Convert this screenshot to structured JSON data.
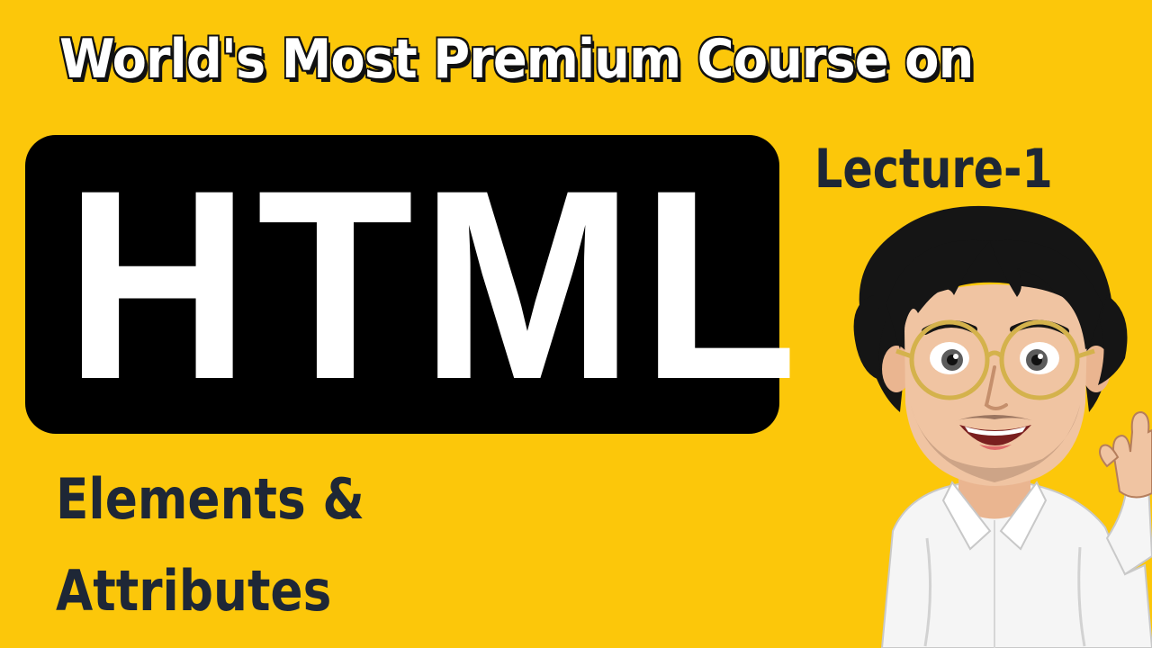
{
  "headline": "World's Most Premium Course on",
  "title": "HTML",
  "lecture": "Lecture-1",
  "subtitle": {
    "line1": "Elements &",
    "line2": "Attributes"
  },
  "mascot": {
    "icon": "cartoon-teacher-waving",
    "colors": {
      "background": "#fcc70a",
      "title_box": "#000000",
      "text_dark": "#1e2736",
      "hair": "#151515",
      "skin": "#f0c4a2",
      "shirt": "#f5f5f5",
      "glasses": "#d4b24c"
    }
  }
}
